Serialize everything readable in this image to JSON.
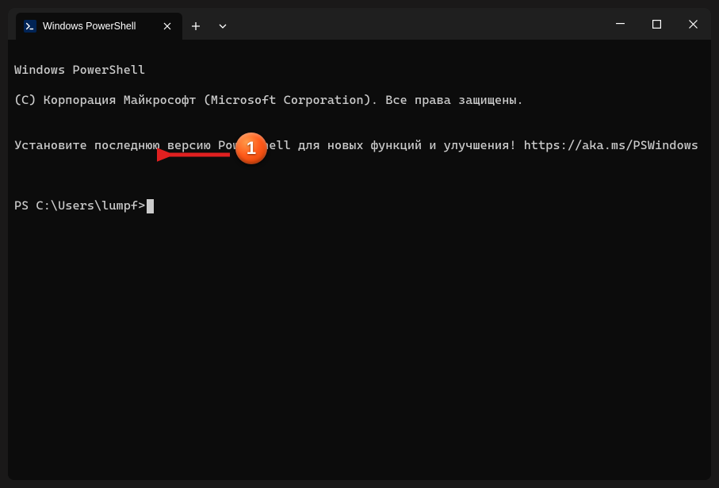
{
  "tab": {
    "title": "Windows PowerShell",
    "icon_label": ">_"
  },
  "window_controls": {
    "minimize_tip": "Minimize",
    "maximize_tip": "Maximize",
    "close_tip": "Close"
  },
  "terminal": {
    "line1": "Windows PowerShell",
    "line2": "(C) Корпорация Майкрософт (Microsoft Corporation). Все права защищены.",
    "blank1": "",
    "line3": "Установите последнюю версию PowerShell для новых функций и улучшения! https://aka.ms/PSWindows",
    "blank2": "",
    "blank3": "",
    "prompt": "PS C:\\Users\\lumpf>"
  },
  "annotation": {
    "badge_number": "1"
  }
}
